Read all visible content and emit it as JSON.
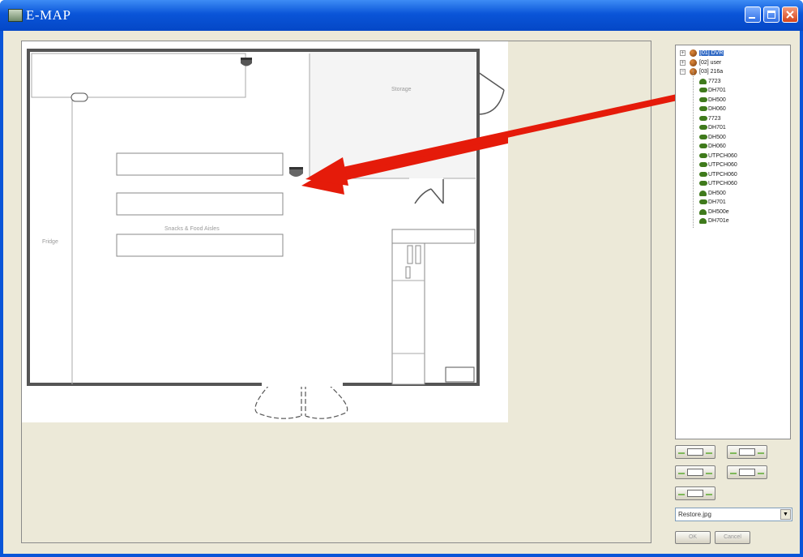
{
  "window": {
    "title": "E-MAP",
    "colors": {
      "titlebar": "#0a55d8",
      "client": "#ece9d8",
      "arrow": "#e51b0a",
      "selection": "#316ac5",
      "camera": "#3f7a1c"
    }
  },
  "titlebar_buttons": {
    "minimize_icon": "minimize-icon",
    "maximize_icon": "maximize-icon",
    "close_icon": "close-icon"
  },
  "map": {
    "image_file": "Restore.jpg",
    "rooms": {
      "storage": "Storage",
      "fridge": "Fridge",
      "aisles": "Snacks & Food Aisles"
    }
  },
  "tree": {
    "servers": [
      {
        "label": "[01] DVR",
        "expander": "+",
        "selected": true
      },
      {
        "label": "[02] user",
        "expander": "+",
        "selected": false
      },
      {
        "label": "[03] 216a",
        "expander": "−",
        "selected": false
      }
    ],
    "cameras": [
      {
        "label": "7723",
        "icon": "dome-camera-icon"
      },
      {
        "label": "DH701",
        "icon": "box-camera-icon"
      },
      {
        "label": "DH500",
        "icon": "box-camera-icon"
      },
      {
        "label": "DH060",
        "icon": "box-camera-icon"
      },
      {
        "label": "7723",
        "icon": "box-camera-icon"
      },
      {
        "label": "DH701",
        "icon": "box-camera-icon"
      },
      {
        "label": "DH500",
        "icon": "box-camera-icon"
      },
      {
        "label": "DH060",
        "icon": "box-camera-icon"
      },
      {
        "label": "UTPCH060",
        "icon": "box-camera-icon"
      },
      {
        "label": "UTPCH060",
        "icon": "box-camera-icon"
      },
      {
        "label": "UTPCH060",
        "icon": "box-camera-icon"
      },
      {
        "label": "UTPCH060",
        "icon": "box-camera-icon"
      },
      {
        "label": "DH500",
        "icon": "dome-camera-icon"
      },
      {
        "label": "DH701",
        "icon": "box-camera-icon"
      },
      {
        "label": "DH500e",
        "icon": "dome-camera-icon"
      },
      {
        "label": "DH701e",
        "icon": "dome-camera-icon"
      }
    ]
  },
  "map_tools": [
    "add-map-icon",
    "edit-map-icon",
    "open-map-icon",
    "save-map-icon",
    "delete-map-icon"
  ],
  "combo": {
    "value": "Restore.jpg",
    "arrow": "▼"
  },
  "footer": {
    "ok": "OK",
    "cancel": "Cancel"
  }
}
